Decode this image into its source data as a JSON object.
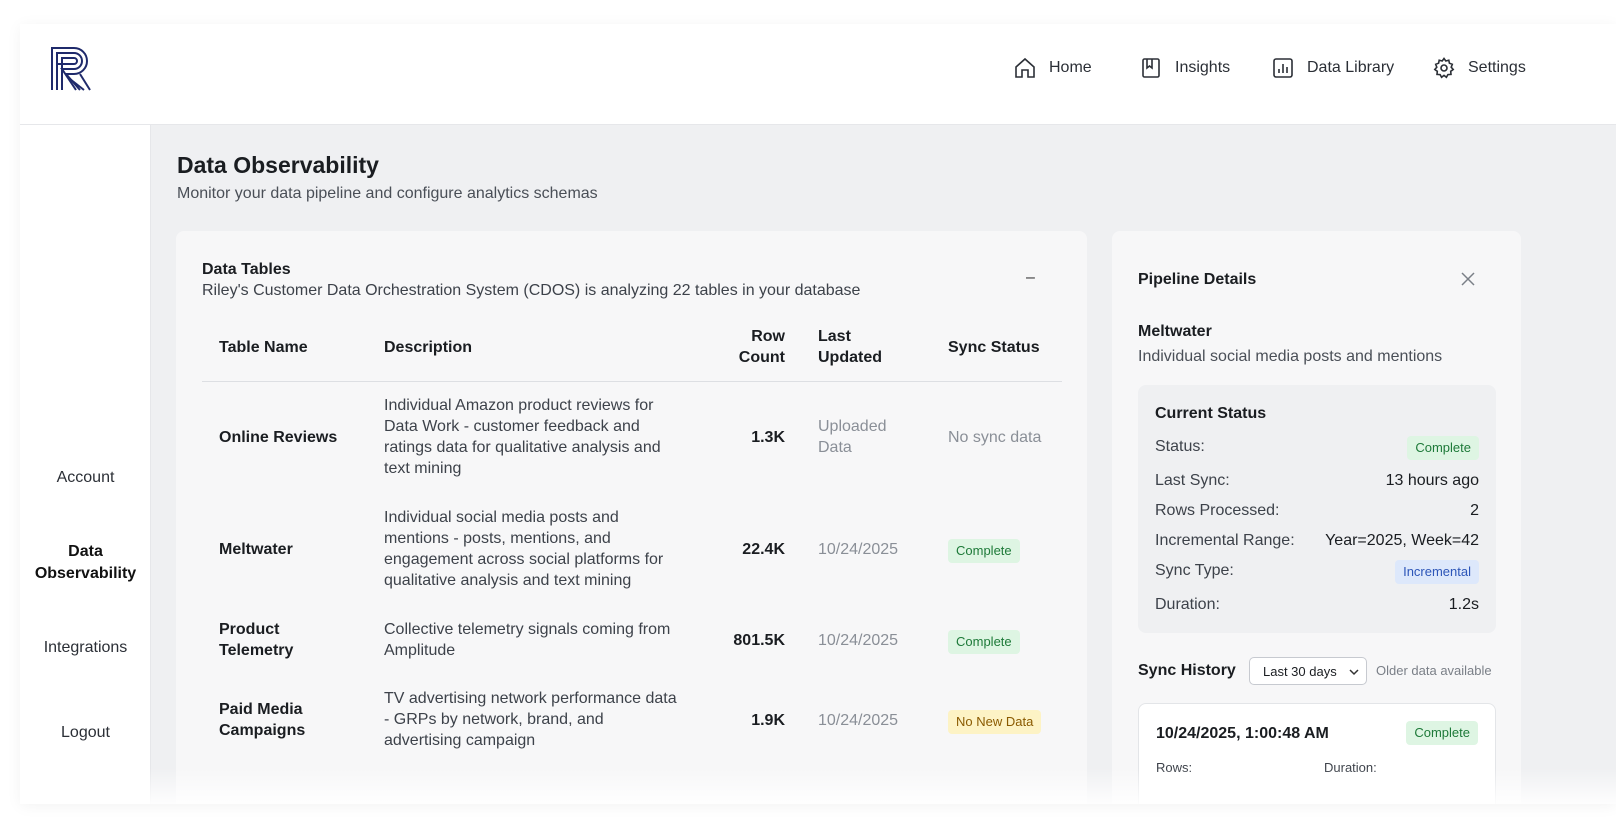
{
  "header": {
    "nav": [
      {
        "label": "Home",
        "icon": "home-icon"
      },
      {
        "label": "Insights",
        "icon": "book-icon"
      },
      {
        "label": "Data Library",
        "icon": "bar-chart-icon"
      },
      {
        "label": "Settings",
        "icon": "gear-icon"
      }
    ]
  },
  "sidebar": {
    "items": [
      {
        "label": "Account"
      },
      {
        "label": "Data Observability",
        "active": true
      },
      {
        "label": "Integrations"
      },
      {
        "label": "Logout"
      }
    ]
  },
  "page": {
    "title": "Data Observability",
    "subtitle": "Monitor your data pipeline and configure analytics schemas"
  },
  "tables_card": {
    "title": "Data Tables",
    "subtitle": "Riley's Customer Data Orchestration System (CDOS) is analyzing 22 tables in your database",
    "collapse_label": "–",
    "columns": {
      "name": "Table Name",
      "description": "Description",
      "rows": "Row Count",
      "updated": "Last Updated",
      "status": "Sync Status"
    },
    "rows": [
      {
        "name": "Online Reviews",
        "description": "Individual Amazon product reviews for Data Work - customer feedback and ratings data for qualitative analysis and text mining",
        "row_count": "1.3K",
        "updated": "Uploaded Data",
        "status": "No sync data",
        "status_type": "none"
      },
      {
        "name": "Meltwater",
        "description": "Individual social media posts and mentions - posts, mentions, and engagement across social platforms for qualitative analysis and text mining",
        "row_count": "22.4K",
        "updated": "10/24/2025",
        "status": "Complete",
        "status_type": "complete"
      },
      {
        "name": "Product Telemetry",
        "description": "Collective telemetry signals coming from Amplitude",
        "row_count": "801.5K",
        "updated": "10/24/2025",
        "status": "Complete",
        "status_type": "complete"
      },
      {
        "name": "Paid Media Campaigns",
        "description": "TV advertising network performance data - GRPs by network, brand, and advertising campaign",
        "row_count": "1.9K",
        "updated": "10/24/2025",
        "status": "No New Data",
        "status_type": "nonew"
      }
    ]
  },
  "pipeline": {
    "title": "Pipeline Details",
    "source_name": "Meltwater",
    "source_desc": "Individual social media posts and mentions",
    "current_status": {
      "title": "Current Status",
      "status_label": "Status:",
      "status_value": "Complete",
      "last_sync_label": "Last Sync:",
      "last_sync_value": "13 hours ago",
      "rows_label": "Rows Processed:",
      "rows_value": "2",
      "range_label": "Incremental Range:",
      "range_value": "Year=2025, Week=42",
      "type_label": "Sync Type:",
      "type_value": "Incremental",
      "duration_label": "Duration:",
      "duration_value": "1.2s"
    },
    "history": {
      "title": "Sync History",
      "range_selected": "Last 30 days",
      "older_note": "Older data available",
      "entries": [
        {
          "date": "10/24/2025, 1:00:48 AM",
          "status": "Complete",
          "rows_label": "Rows:",
          "duration_label": "Duration:"
        }
      ]
    }
  },
  "colors": {
    "accent_navy": "#1f2a6b",
    "complete_bg": "#def5e3",
    "complete_fg": "#1e7a39",
    "nonew_bg": "#fdf3c5",
    "incremental_bg": "#dde8fb"
  }
}
